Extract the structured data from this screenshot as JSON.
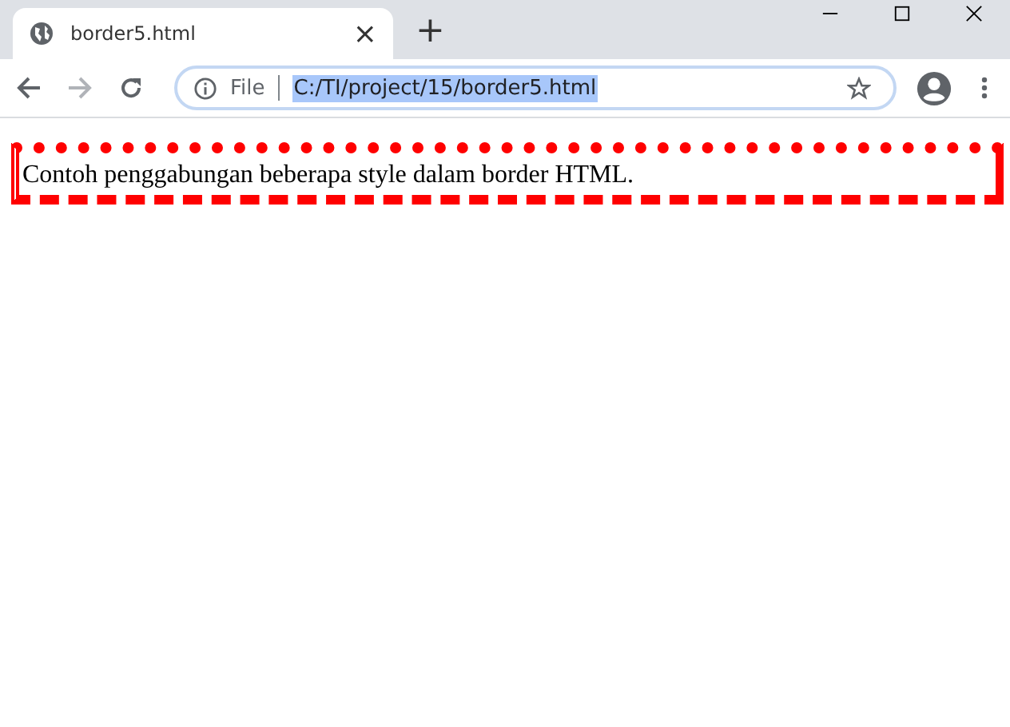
{
  "tab": {
    "title": "border5.html",
    "close": "×"
  },
  "new_tab": "+",
  "address_bar": {
    "scheme": "File",
    "url": "C:/TI/project/15/border5.html",
    "url_selected": true
  },
  "page": {
    "paragraph": "Contoh penggabungan beberapa style dalam border HTML."
  }
}
